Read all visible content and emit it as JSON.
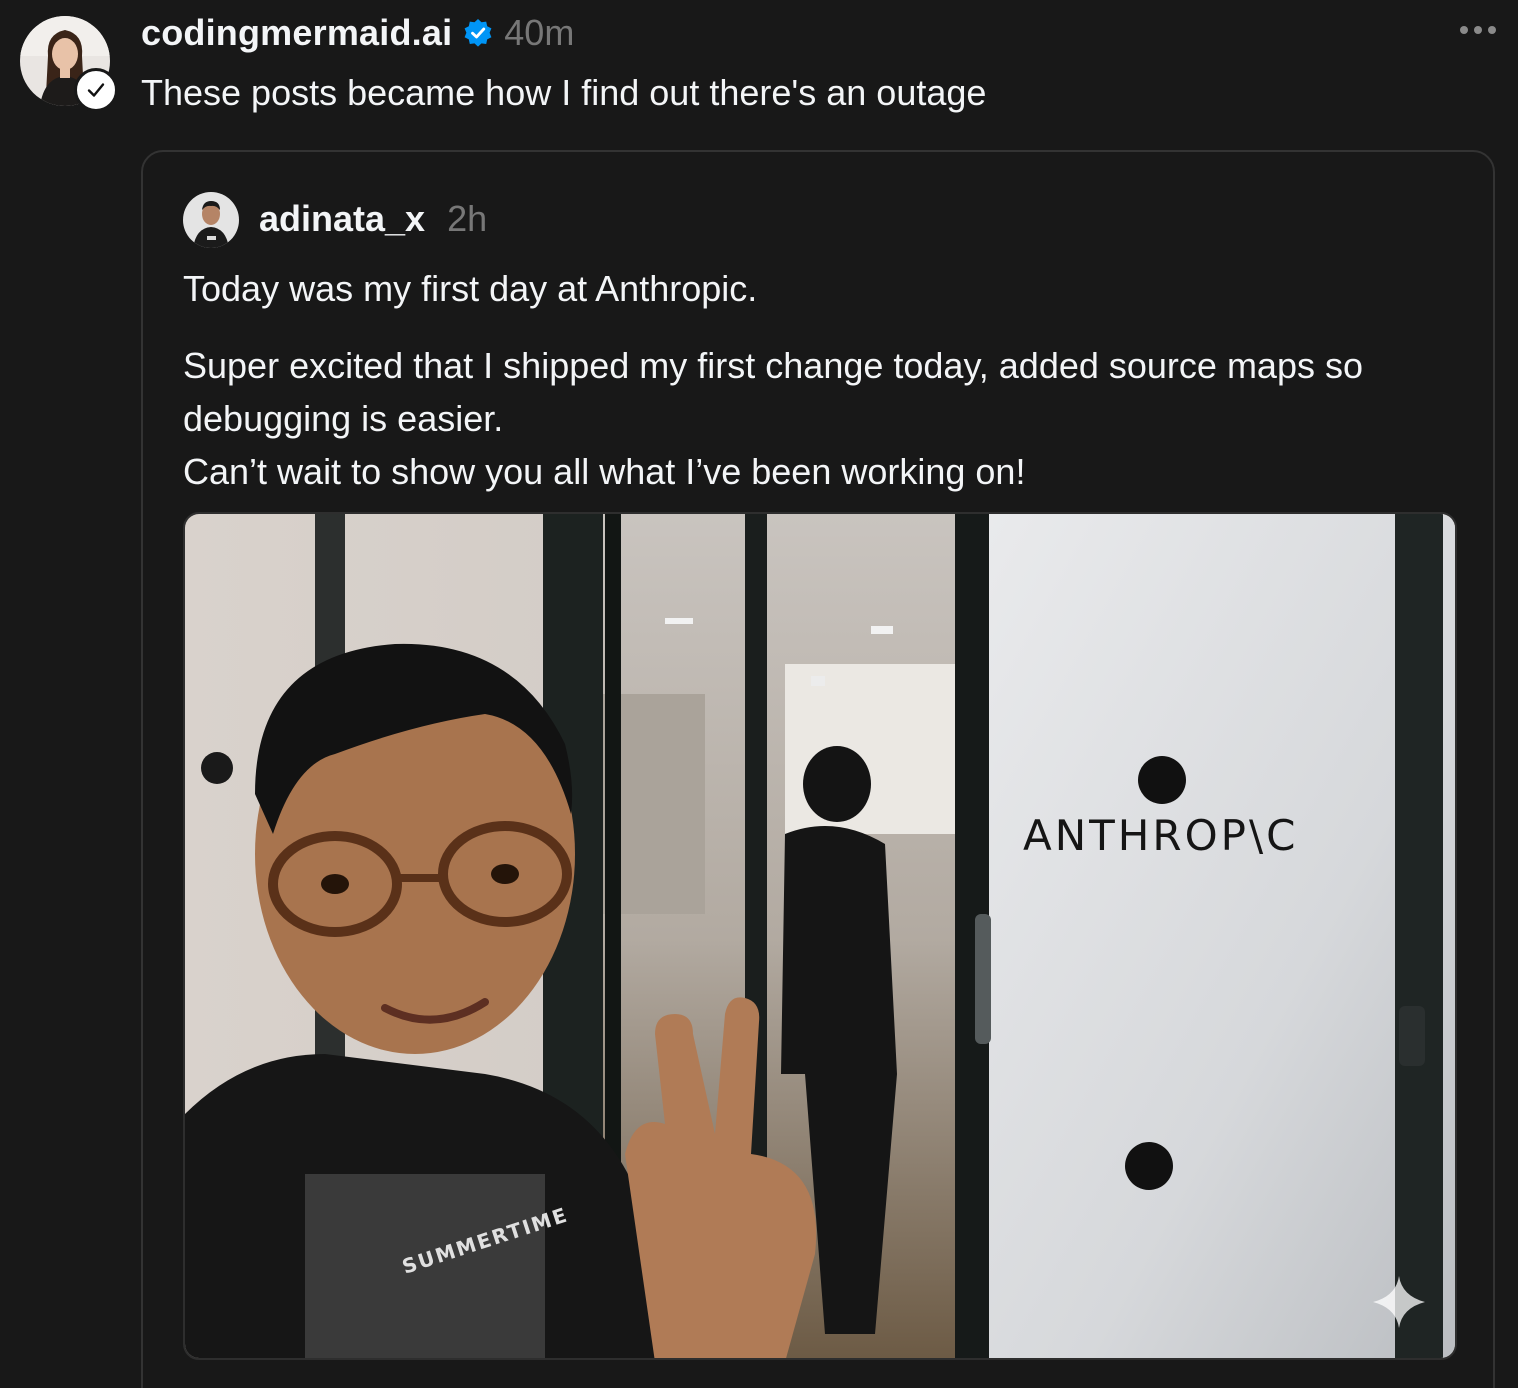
{
  "post": {
    "author": "codingmermaid.ai",
    "time": "40m",
    "text": "These posts became how I find out there's an outage"
  },
  "quoted_post": {
    "author": "adinata_x",
    "time": "2h",
    "paragraphs": [
      "Today was my first day at Anthropic.",
      "Super excited that I shipped my first change today, added source maps so debugging is easier.",
      "Can’t wait to show you all what I’ve been working on!"
    ],
    "photo": {
      "sign_text": "ANTHROP\\C",
      "shirt_text": "SUMMERTIME"
    }
  },
  "colors": {
    "background": "#181818",
    "text_primary": "#f3f5f7",
    "text_secondary": "#777777",
    "verified_blue": "#0095f6",
    "card_border": "#333333"
  },
  "icons": {
    "verified": "verified-badge-icon",
    "more": "more-horizontal-icon",
    "ai_sparkle": "sparkle-icon",
    "follow_check": "checkmark-icon"
  }
}
